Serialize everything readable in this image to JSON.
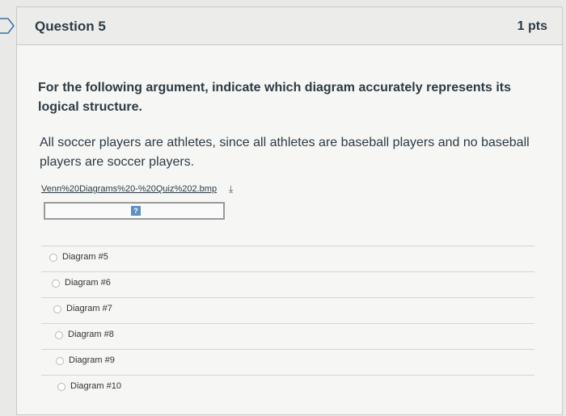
{
  "question": {
    "title": "Question 5",
    "points": "1 pts",
    "prompt": "For the following argument, indicate which diagram accurately represents its logical structure.",
    "argument": "All soccer players are athletes, since all athletes are baseball players and no baseball players are soccer players.",
    "file_link": "Venn%20Diagrams%20-%20Quiz%202.bmp",
    "answers": [
      "Diagram #5",
      "Diagram #6",
      "Diagram #7",
      "Diagram #8",
      "Diagram #9",
      "Diagram #10"
    ]
  }
}
